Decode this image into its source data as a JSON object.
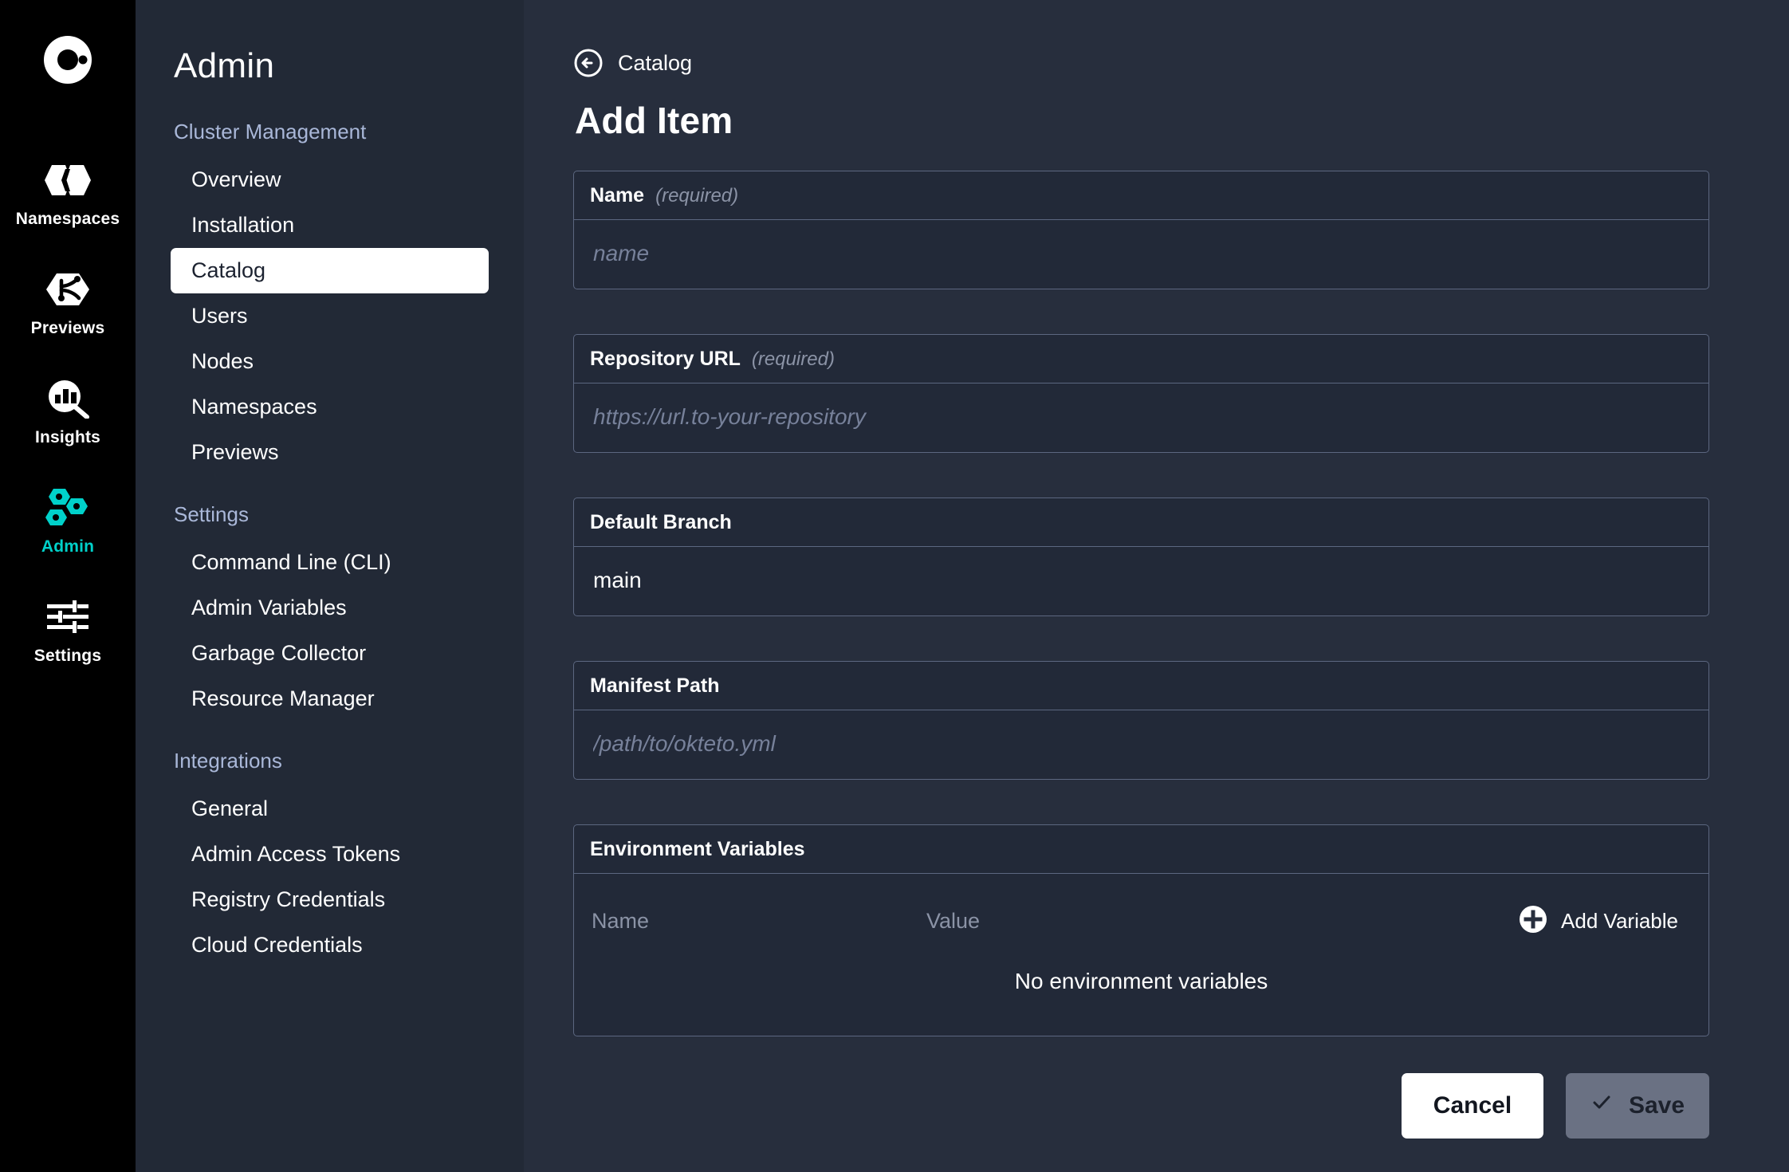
{
  "rail": {
    "logo_icon": "okteto-logo-icon",
    "items": [
      {
        "label": "Namespaces",
        "icon": "namespaces-icon",
        "active": false
      },
      {
        "label": "Previews",
        "icon": "previews-icon",
        "active": false
      },
      {
        "label": "Insights",
        "icon": "insights-icon",
        "active": false
      },
      {
        "label": "Admin",
        "icon": "admin-icon",
        "active": true
      },
      {
        "label": "Settings",
        "icon": "settings-sliders-icon",
        "active": false
      }
    ],
    "active_color": "#00d1ca"
  },
  "sidebar": {
    "title": "Admin",
    "groups": [
      {
        "title": "Cluster Management",
        "items": [
          {
            "label": "Overview",
            "active": false
          },
          {
            "label": "Installation",
            "active": false
          },
          {
            "label": "Catalog",
            "active": true
          },
          {
            "label": "Users",
            "active": false
          },
          {
            "label": "Nodes",
            "active": false
          },
          {
            "label": "Namespaces",
            "active": false
          },
          {
            "label": "Previews",
            "active": false
          }
        ]
      },
      {
        "title": "Settings",
        "items": [
          {
            "label": "Command Line (CLI)",
            "active": false
          },
          {
            "label": "Admin Variables",
            "active": false
          },
          {
            "label": "Garbage Collector",
            "active": false
          },
          {
            "label": "Resource Manager",
            "active": false
          }
        ]
      },
      {
        "title": "Integrations",
        "items": [
          {
            "label": "General",
            "active": false
          },
          {
            "label": "Admin Access Tokens",
            "active": false
          },
          {
            "label": "Registry Credentials",
            "active": false
          },
          {
            "label": "Cloud Credentials",
            "active": false
          }
        ]
      }
    ]
  },
  "main": {
    "breadcrumb": {
      "label": "Catalog",
      "icon": "back-arrow-circle-icon"
    },
    "title": "Add Item",
    "fields": {
      "name": {
        "label": "Name",
        "required_text": "(required)",
        "value": "",
        "placeholder": "name"
      },
      "repository_url": {
        "label": "Repository URL",
        "required_text": "(required)",
        "value": "",
        "placeholder": "https://url.to-your-repository"
      },
      "default_branch": {
        "label": "Default Branch",
        "required_text": "",
        "value": "main",
        "placeholder": ""
      },
      "manifest_path": {
        "label": "Manifest Path",
        "required_text": "",
        "value": "",
        "placeholder": "/path/to/okteto.yml"
      }
    },
    "environment_variables": {
      "label": "Environment Variables",
      "columns": {
        "name": "Name",
        "value": "Value"
      },
      "rows": [],
      "empty_text": "No environment variables",
      "add_button": {
        "label": "Add Variable",
        "icon": "plus-circle-icon"
      }
    },
    "footer": {
      "cancel_label": "Cancel",
      "save_label": "Save",
      "save_icon": "check-icon",
      "save_disabled": true
    }
  }
}
